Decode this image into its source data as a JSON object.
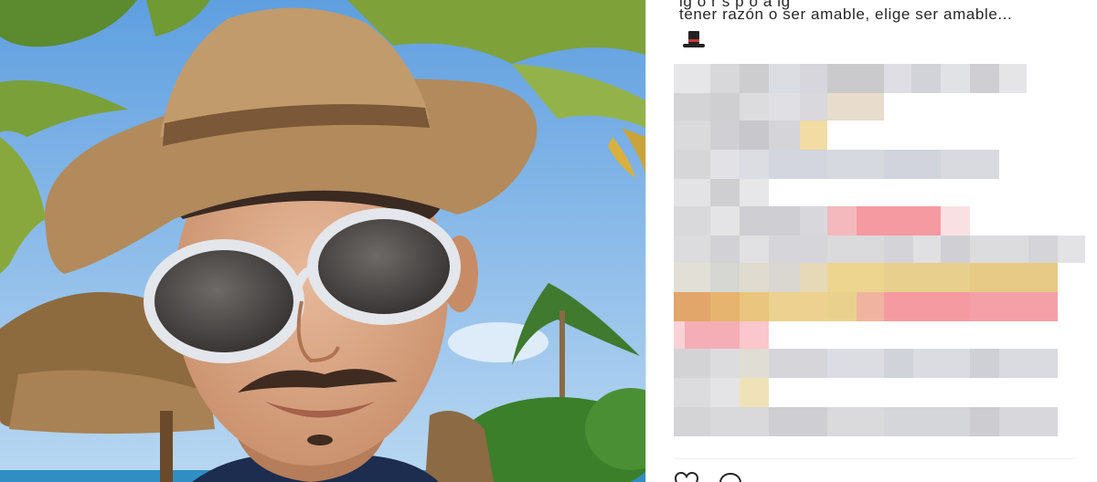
{
  "post": {
    "caption_cut": "ig   o   r  s   p   o  a   ig",
    "caption_line": "tener razón o ser amable, elige ser amable...",
    "emoji_icon": "top-hat-icon"
  },
  "blurred_comment_icon": "pixelated-censored-text",
  "actions": {
    "like_icon": "heart-icon",
    "comment_icon": "comment-icon"
  },
  "colors": {
    "sky": "#7fb6e4",
    "text": "#262626",
    "pixel_gray": "#d3d3d6",
    "pixel_pink": "#f2a0a6",
    "pixel_yellow": "#e8cf8e",
    "pixel_orange": "#e2a56a"
  }
}
